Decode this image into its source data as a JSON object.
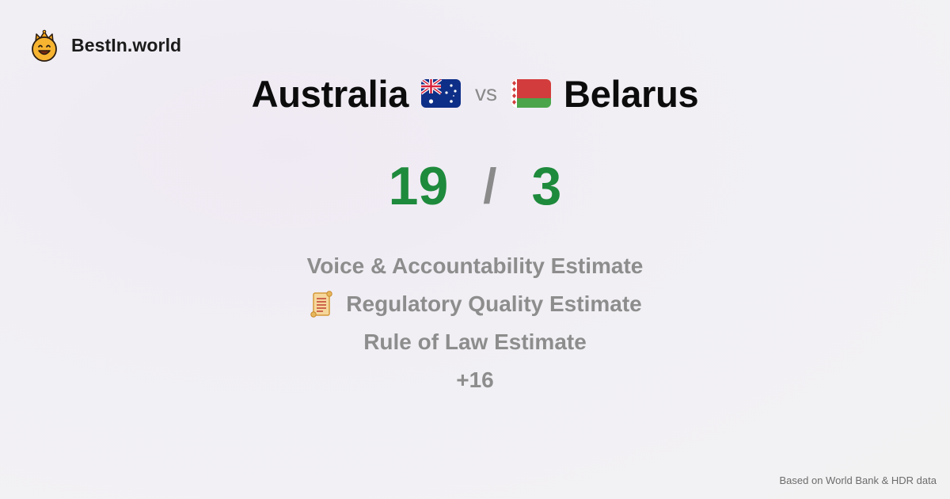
{
  "brand": {
    "name": "BestIn.world",
    "icon": "crown-smiley-icon"
  },
  "comparison": {
    "country_a": {
      "name": "Australia",
      "flag_icon": "australia-flag-icon",
      "score": "19"
    },
    "vs_label": "vs",
    "country_b": {
      "name": "Belarus",
      "flag_icon": "belarus-flag-icon",
      "score": "3"
    },
    "separator": "/"
  },
  "metrics": {
    "items": [
      {
        "label": "Voice & Accountability Estimate"
      },
      {
        "label": "Regulatory Quality Estimate",
        "icon": "scroll-icon"
      },
      {
        "label": "Rule of Law Estimate"
      }
    ],
    "more_label": "+16"
  },
  "footer": {
    "source_note": "Based on World Bank & HDR data"
  },
  "colors": {
    "score_green": "#1e8a3c",
    "muted_gray": "#8d8d8d",
    "title_black": "#0c0c0c"
  }
}
